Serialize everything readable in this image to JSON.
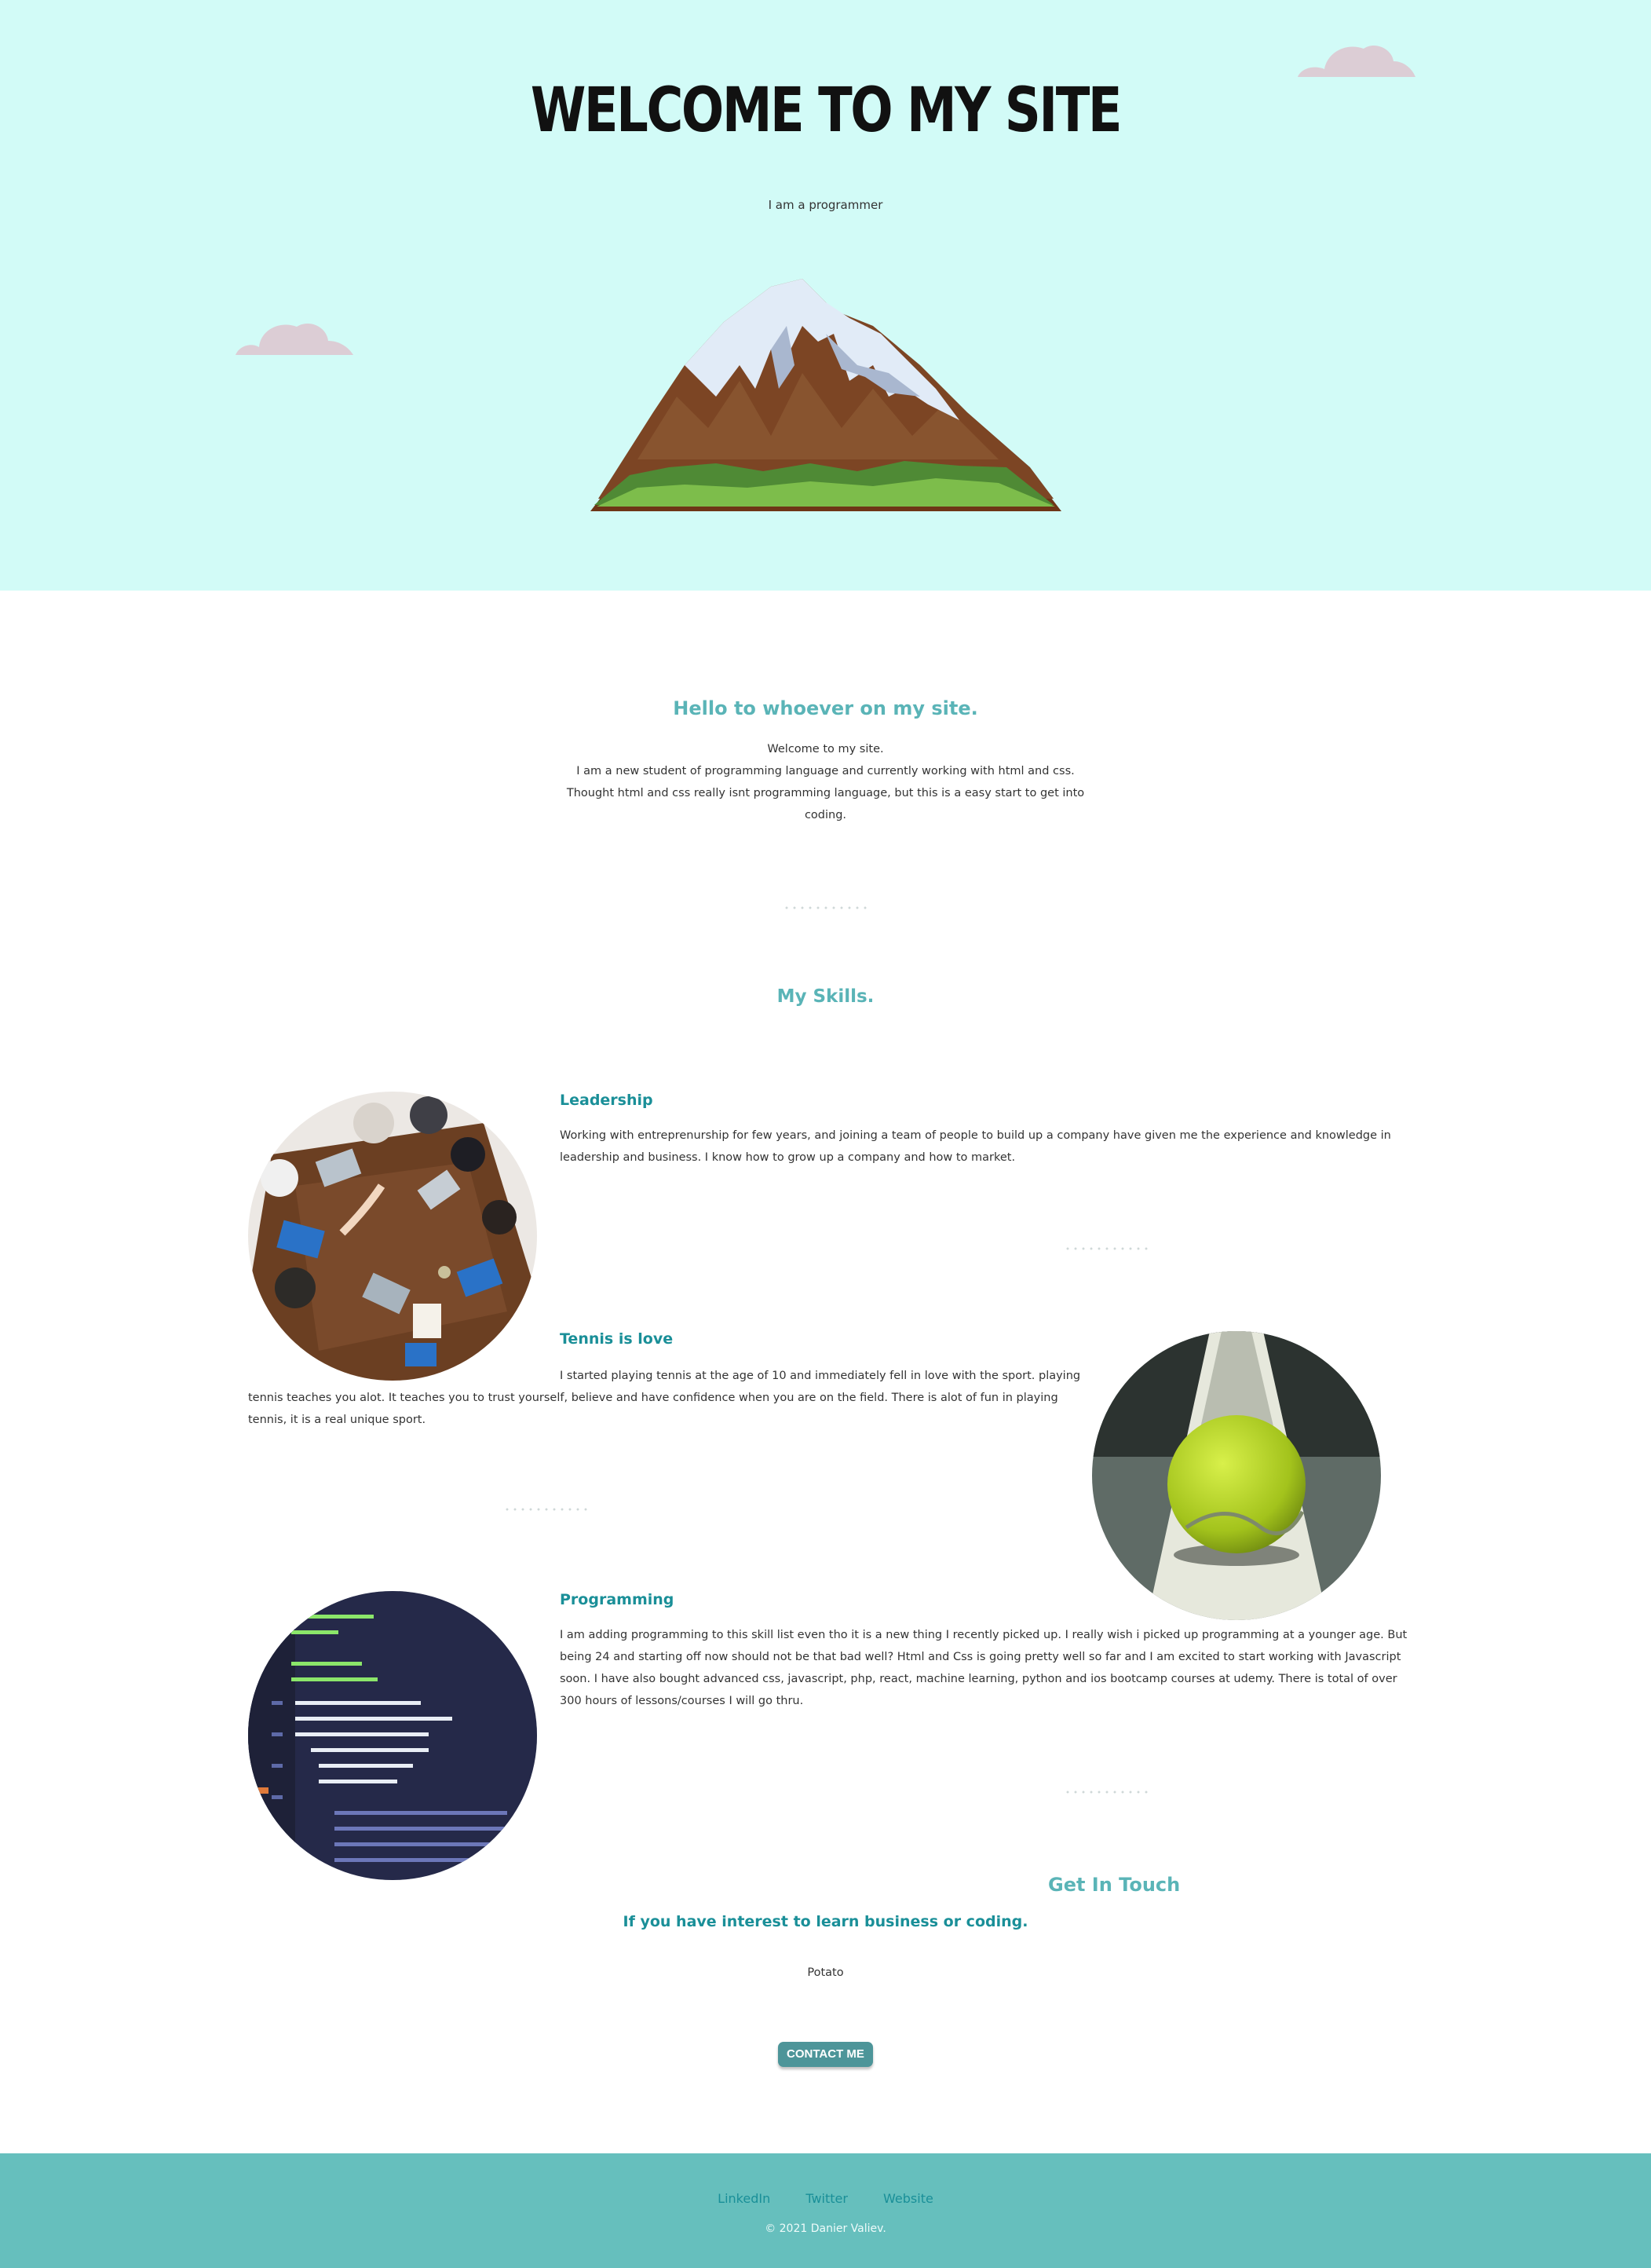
{
  "hero": {
    "title": "WELCOME TO MY SITE",
    "subtitle": "I am a programmer",
    "background": "#d2fbf7"
  },
  "intro": {
    "heading": "Hello to whoever on my site.",
    "lines": [
      "Welcome to my site.",
      "I am a new student of programming language and currently working with html and css.",
      "Thought html and css really isnt programming language, but this is a easy start to get into",
      "coding."
    ]
  },
  "skills": {
    "heading": "My Skills.",
    "items": [
      {
        "title": "Leadership",
        "text": "Working with entreprenurship for few years, and joining a team of people to build up a company have given me the experience and knowledge in leadership and business. I know how to grow up a company and how to market.",
        "image_icon": "team-meeting-photo"
      },
      {
        "title": "Tennis is love",
        "text": "I started playing tennis at the age of 10 and immediately fell in love with the sport. playing tennis teaches you alot. It teaches you to trust yourself, believe and have confidence when you are on the field. There is alot of fun in playing tennis, it is a real unique sport.",
        "image_icon": "tennis-ball-photo"
      },
      {
        "title": "Programming",
        "text": "I am adding programming to this skill list even tho it is a new thing I recently picked up. I really wish i picked up programming at a younger age. But being 24 and starting off now should not be that bad well? Html and Css is going pretty well so far and I am excited to start working with Javascript soon. I have also bought advanced css, javascript, php, react, machine learning, python and ios bootcamp courses at udemy. There is total of over 300 hours of lessons/courses I will go thru.",
        "image_icon": "code-screen-photo"
      }
    ]
  },
  "contact": {
    "heading": "Get In Touch",
    "subheading": "If you have interest to learn business or coding.",
    "text": "Potato",
    "button_label": "CONTACT ME"
  },
  "footer": {
    "links": [
      "LinkedIn",
      "Twitter",
      "Website"
    ],
    "copyright": "© 2021  Danier Valiev.",
    "background": "#66bfbd"
  },
  "colors": {
    "accent_teal": "#5ab4b7",
    "dark_teal": "#1a8f98",
    "button": "#4d9599"
  }
}
